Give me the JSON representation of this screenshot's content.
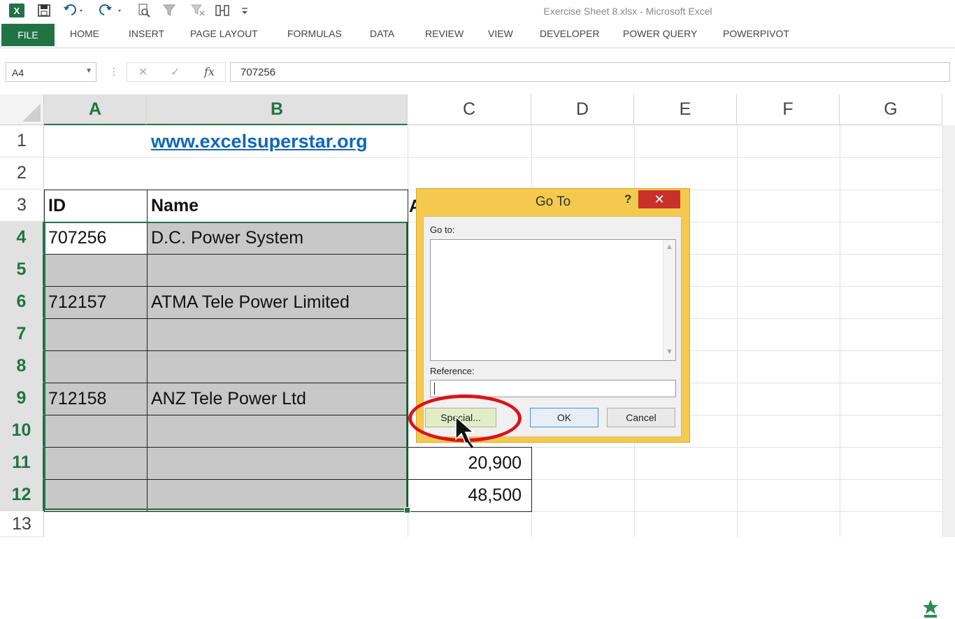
{
  "window": {
    "title": "Exercise Sheet 8.xlsx - Microsoft Excel"
  },
  "quick_access": {
    "icons": [
      "excel-logo-icon",
      "save-icon",
      "undo-icon",
      "redo-icon",
      "print-preview-icon",
      "filter-icon",
      "clear-filter-icon",
      "sort-icon",
      "customize-qat-icon"
    ],
    "excel_logo_glyph": "X"
  },
  "ribbon": {
    "file_label": "FILE",
    "tabs": [
      "HOME",
      "INSERT",
      "PAGE LAYOUT",
      "FORMULAS",
      "DATA",
      "REVIEW",
      "VIEW",
      "DEVELOPER",
      "POWER QUERY",
      "POWERPIVOT"
    ]
  },
  "formula_bar": {
    "name_box": "A4",
    "cancel_glyph": "✕",
    "enter_glyph": "✓",
    "fx_glyph": "fx",
    "value": "707256"
  },
  "sheet": {
    "columns": [
      "A",
      "B",
      "C",
      "D",
      "E",
      "F",
      "G"
    ],
    "rows": [
      "1",
      "2",
      "3",
      "4",
      "5",
      "6",
      "7",
      "8",
      "9",
      "10",
      "11",
      "12",
      "13"
    ],
    "link": "www.excelsuperstar.org",
    "header_id": "ID",
    "header_name": "Name",
    "header_c_peek": "A",
    "data": [
      {
        "id": "707256",
        "name": "D.C. Power System"
      },
      {
        "id": "",
        "name": ""
      },
      {
        "id": "712157",
        "name": "ATMA Tele Power Limited"
      },
      {
        "id": "",
        "name": ""
      },
      {
        "id": "",
        "name": ""
      },
      {
        "id": "712158",
        "name": "ANZ Tele Power Ltd"
      },
      {
        "id": "",
        "name": ""
      },
      {
        "id": "",
        "name": ""
      },
      {
        "id": "",
        "name": ""
      }
    ],
    "c11": "20,900",
    "c12": "48,500"
  },
  "dialog": {
    "title": "Go To",
    "help": "?",
    "close": "✕",
    "goto_label": "Go to:",
    "reference_label": "Reference:",
    "reference_value": "",
    "special_button": "Special...",
    "ok_button": "OK",
    "cancel_button": "Cancel"
  },
  "accent": "#217346",
  "annotation_color": "#d9141b"
}
